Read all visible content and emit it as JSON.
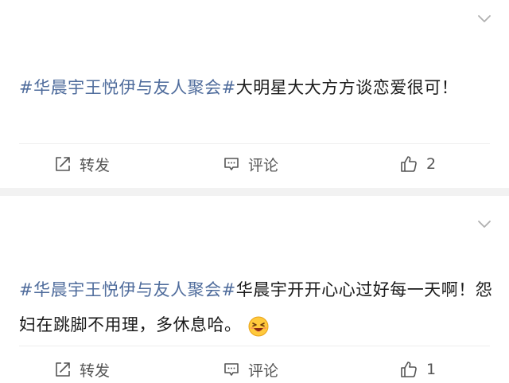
{
  "posts": [
    {
      "topic": "#华晨宇王悦伊与友人聚会#",
      "body": "大明星大大方方谈恋爱很可！",
      "emoji": "",
      "actions": {
        "repost_label": "转发",
        "comment_label": "评论",
        "like_count": "2"
      }
    },
    {
      "topic": "#华晨宇王悦伊与友人聚会#",
      "body": "华晨宇开开心心过好每一天啊！怨妇在跳脚不用理，多休息哈。",
      "emoji": "lol-face-emoji",
      "actions": {
        "repost_label": "转发",
        "comment_label": "评论",
        "like_count": "1"
      }
    }
  ],
  "colors": {
    "topic": "#4f6c9c",
    "text": "#1a1a1a",
    "action": "#555555",
    "separator": "#f2f2f2"
  },
  "icons": {
    "menu": "chevron-down-icon",
    "repost": "repost-icon",
    "comment": "comment-icon",
    "like": "thumbs-up-icon"
  }
}
